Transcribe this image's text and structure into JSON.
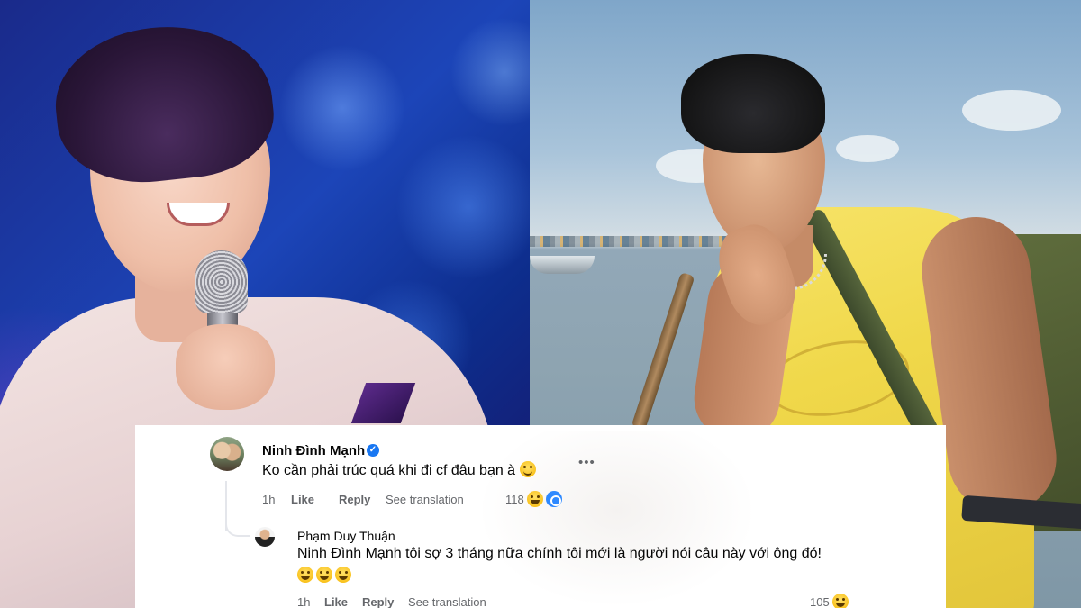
{
  "comment": {
    "author": "Ninh Đình Mạnh",
    "text": "Ko cần phải trúc quá khi đi cf đâu bạn à",
    "time": "1h",
    "like_label": "Like",
    "reply_label": "Reply",
    "translate_label": "See translation",
    "reaction_count": "118",
    "more_label": "•••"
  },
  "reply": {
    "author": "Phạm Duy Thuận",
    "mention": "Ninh Đình Mạnh",
    "text": " tôi sợ 3 tháng nữa chính tôi mới là người nói câu này với ông đó!",
    "time": "1h",
    "like_label": "Like",
    "reply_label": "Reply",
    "translate_label": "See translation",
    "reaction_count": "105"
  },
  "icons": {
    "verified": "verified-badge-icon",
    "more": "more-options-icon",
    "emoji_smile": "smile-emoji-icon",
    "emoji_laugh": "laugh-emoji-icon",
    "reaction_wow": "wow-reaction-icon"
  },
  "colors": {
    "facebook_blue": "#1877f2",
    "meta_text": "#65676b",
    "body_text": "#050505"
  }
}
